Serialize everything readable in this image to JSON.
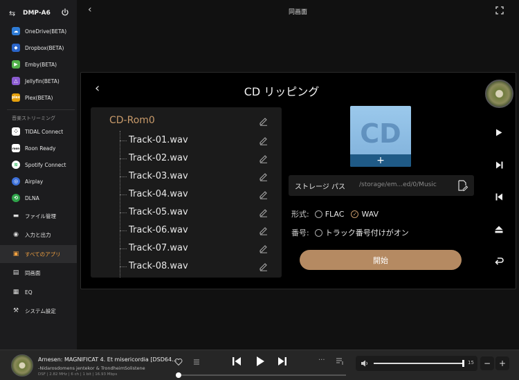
{
  "device": {
    "name": "DMP-A6"
  },
  "sidebar": {
    "services": [
      {
        "label": "OneDrive(BETA)",
        "icon": "onedrive-icon",
        "color": "#2f7cd6"
      },
      {
        "label": "Dropbox(BETA)",
        "icon": "dropbox-icon",
        "color": "#2a64c8"
      },
      {
        "label": "Emby(BETA)",
        "icon": "emby-icon",
        "color": "#52b04a"
      },
      {
        "label": "Jellyfin(BETA)",
        "icon": "jellyfin-icon",
        "color": "#8a5bd0"
      },
      {
        "label": "Plex(BETA)",
        "icon": "plex-icon",
        "color": "#e5a00d"
      }
    ],
    "streaming_section": "音楽ストリーミング",
    "streaming": [
      {
        "label": "TIDAL Connect",
        "icon": "tidal-icon"
      },
      {
        "label": "Roon Ready",
        "icon": "roon-icon"
      },
      {
        "label": "Spotify Connect",
        "icon": "spotify-icon"
      },
      {
        "label": "Airplay",
        "icon": "airplay-icon"
      },
      {
        "label": "DLNA",
        "icon": "dlna-icon"
      }
    ],
    "main": [
      {
        "label": "ファイル管理",
        "icon": "folder-icon"
      },
      {
        "label": "入力と出力",
        "icon": "input-output-icon"
      },
      {
        "label": "すべてのアプリ",
        "icon": "apps-box-icon",
        "active": true
      },
      {
        "label": "同画面",
        "icon": "same-screen-icon"
      },
      {
        "label": "EQ",
        "icon": "eq-icon"
      },
      {
        "label": "システム設定",
        "icon": "settings-icon"
      }
    ]
  },
  "topbar": {
    "title": "同画面"
  },
  "dialog": {
    "title": "CD リッピング",
    "root": "CD-Rom0",
    "tracks": [
      "Track-01.wav",
      "Track-02.wav",
      "Track-03.wav",
      "Track-04.wav",
      "Track-05.wav",
      "Track-06.wav",
      "Track-07.wav",
      "Track-08.wav"
    ],
    "cover_text": "CD",
    "cover_plus": "+",
    "storage_label": "ストレージ パス",
    "storage_path": "/storage/em...ed/0/Music",
    "format_label": "形式:",
    "format_options": [
      "FLAC",
      "WAV"
    ],
    "format_selected": "WAV",
    "number_label": "番号:",
    "number_option": "トラック番号付けがオン",
    "start_label": "開始"
  },
  "player": {
    "title": "Arnesen: MAGNIFICAT 4. Et misericordia [DSD64...",
    "artist": "-Nidarosdomens jentekor & TrondheimSolistene",
    "format": "DSF | 2.82 MHz | 6 ch | 1 bit | 16.93 Mbps",
    "more": "···",
    "volume": "15",
    "minus": "−",
    "plus": "+"
  },
  "colors": {
    "accent": "#c89a6a",
    "button": "#b58a62",
    "active": "#f0a040"
  }
}
